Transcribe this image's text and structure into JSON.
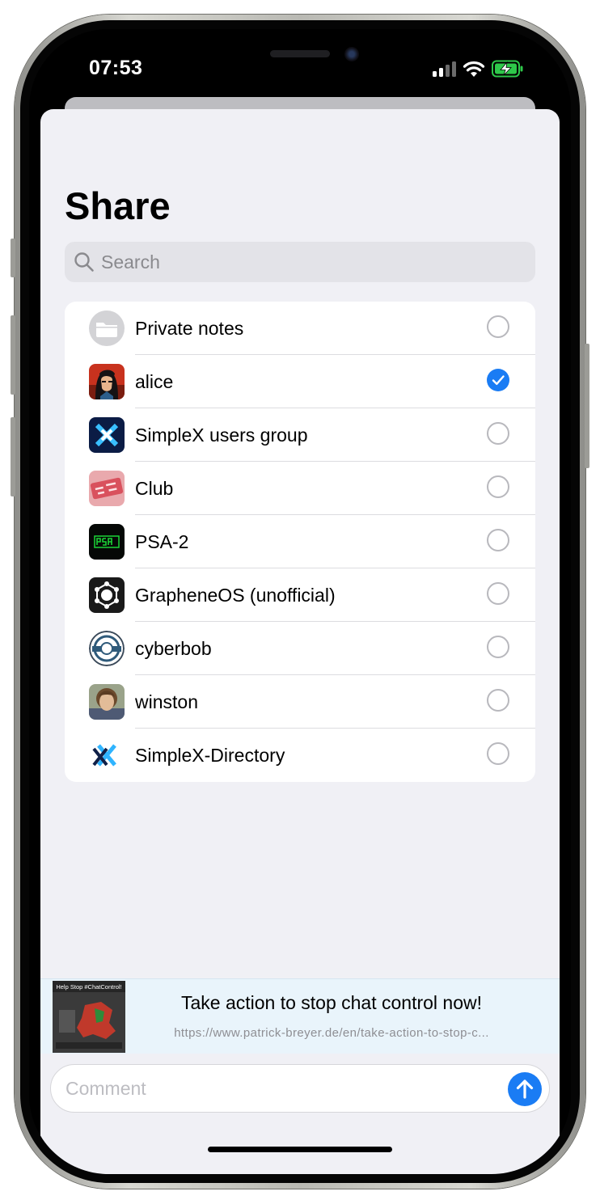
{
  "status_bar": {
    "time": "07:53"
  },
  "share": {
    "title": "Share",
    "search_placeholder": "Search",
    "accent_color": "#1a7cf4",
    "items": [
      {
        "label": "Private notes",
        "icon": "folder-icon",
        "selected": false
      },
      {
        "label": "alice",
        "icon": "alice-avatar",
        "selected": true
      },
      {
        "label": "SimpleX users group",
        "icon": "simplex-group-avatar",
        "selected": false
      },
      {
        "label": "Club",
        "icon": "club-avatar",
        "selected": false
      },
      {
        "label": "PSA-2",
        "icon": "psa-avatar",
        "selected": false
      },
      {
        "label": "GrapheneOS (unofficial)",
        "icon": "grapheneos-avatar",
        "selected": false
      },
      {
        "label": "cyberbob",
        "icon": "cyberbob-avatar",
        "selected": false
      },
      {
        "label": "winston",
        "icon": "winston-avatar",
        "selected": false
      },
      {
        "label": "SimpleX-Directory",
        "icon": "simplex-directory-avatar",
        "selected": false
      }
    ]
  },
  "link_preview": {
    "image_text": "Help Stop #ChatControl!",
    "title": "Take action to stop chat control now!",
    "url": "https://www.patrick-breyer.de/en/take-action-to-stop-c..."
  },
  "composer": {
    "comment_placeholder": "Comment"
  }
}
